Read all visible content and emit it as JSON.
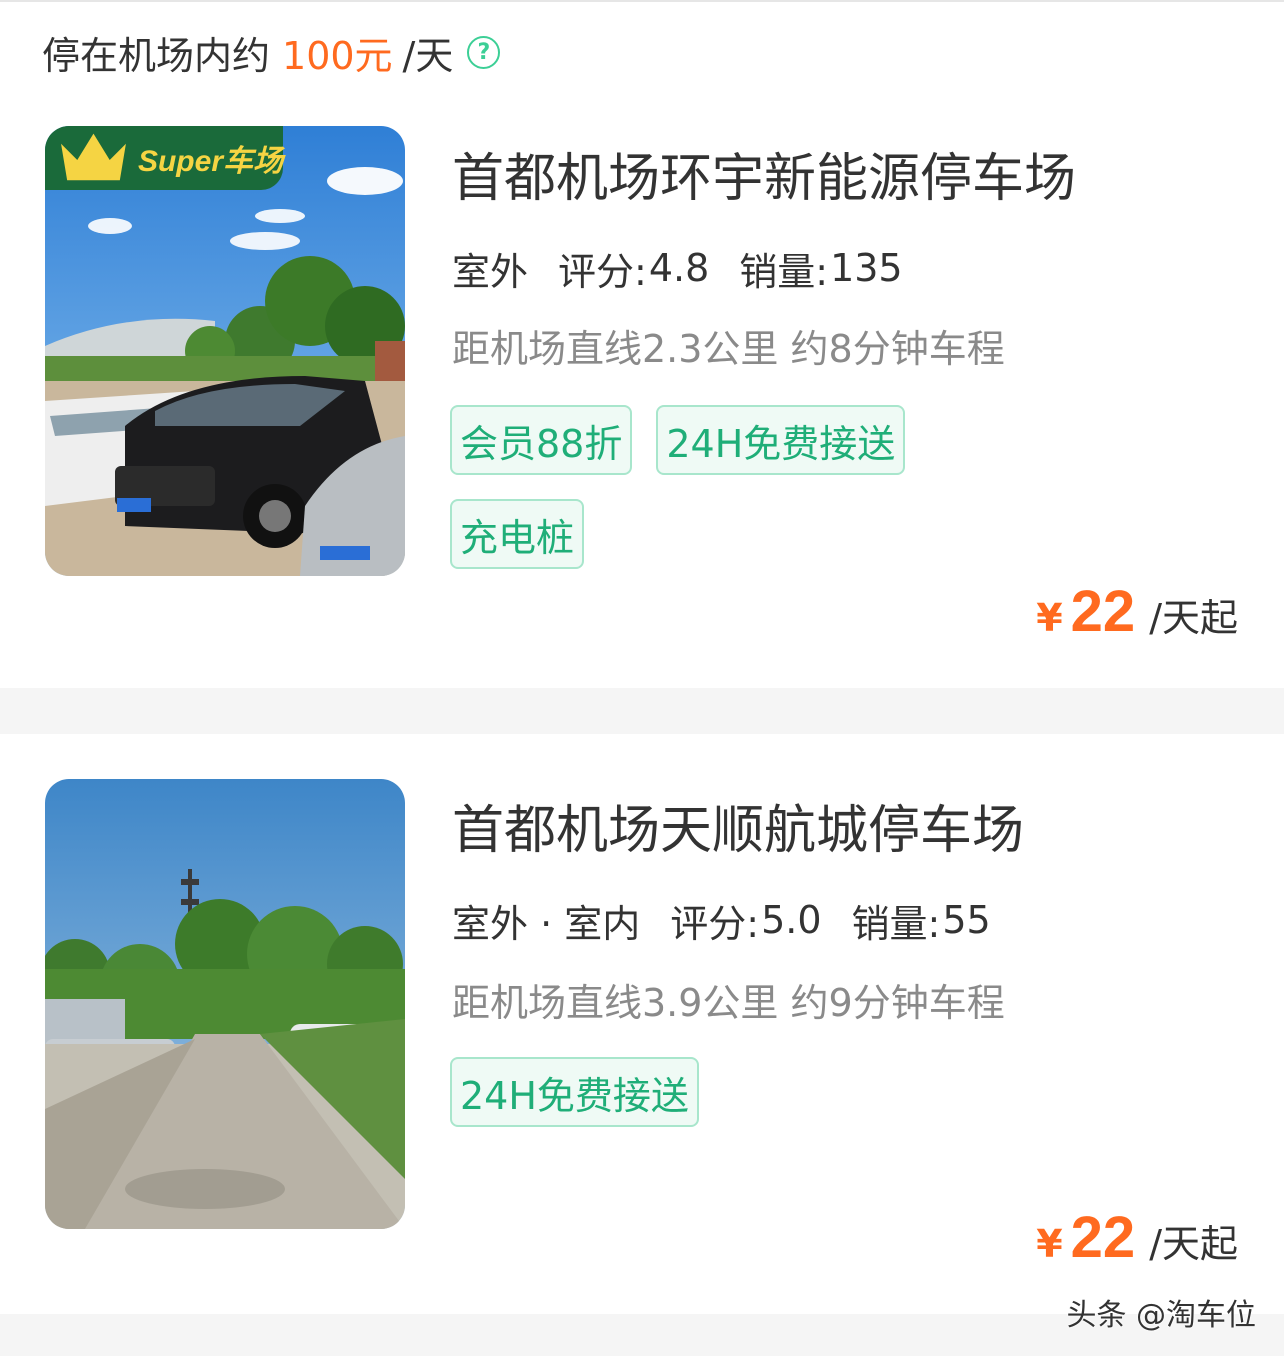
{
  "header": {
    "prefix": "停在机场内约",
    "amount": "100元",
    "unit": "/天",
    "help_icon": "question-circle-icon"
  },
  "listings": [
    {
      "badge": "Super车场",
      "badge_icon": "crown-icon",
      "title": "首都机场环宇新能源停车场",
      "env": "室外",
      "score_label": "评分:",
      "score": "4.8",
      "sales_label": "销量:",
      "sales": "135",
      "distance": "距机场直线2.3公里 约8分钟车程",
      "tags": [
        "会员88折",
        "24H免费接送",
        "充电桩"
      ],
      "price_symbol": "¥",
      "price": "22",
      "price_suffix": "/天起"
    },
    {
      "title": "首都机场天顺航城停车场",
      "env": "室外 · 室内",
      "score_label": "评分:",
      "score": "5.0",
      "sales_label": "销量:",
      "sales": "55",
      "distance": "距机场直线3.9公里 约9分钟车程",
      "tags": [
        "24H免费接送"
      ],
      "price_symbol": "¥",
      "price": "22",
      "price_suffix": "/天起"
    }
  ],
  "watermark": "头条 @淘车位",
  "colors": {
    "accent_orange": "#ff6a1f",
    "tag_green": "#1fae78",
    "tag_border": "#a8e6cc",
    "badge_green": "#1a6a3a"
  }
}
